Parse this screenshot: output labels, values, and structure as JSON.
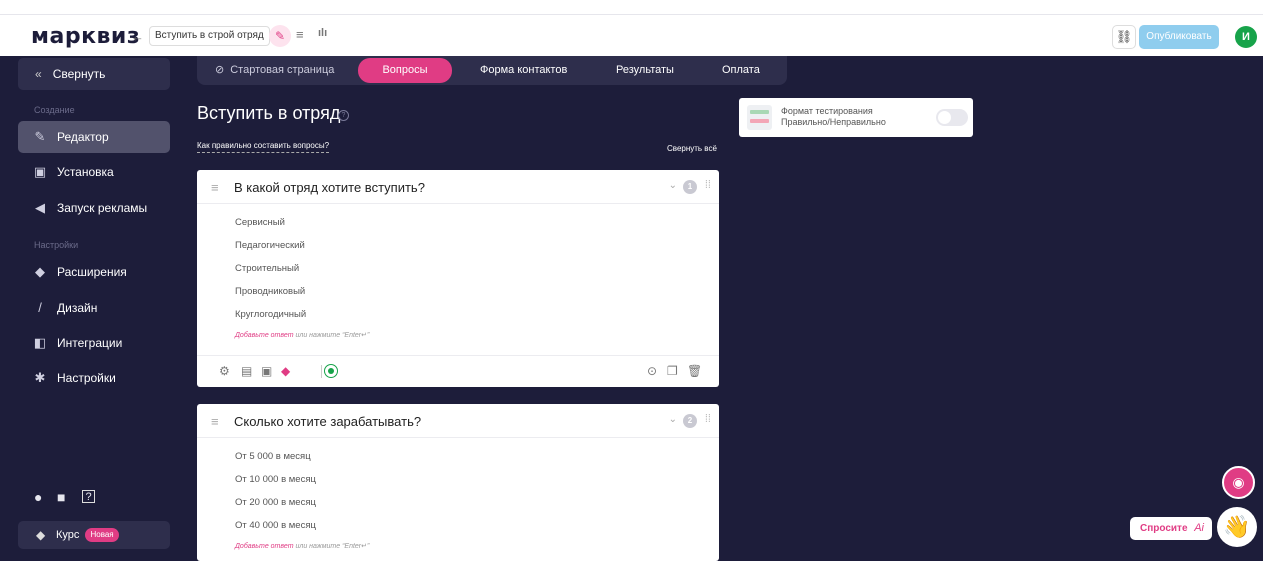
{
  "header": {
    "logo": "марквиз",
    "back": "←",
    "quiz_title": "Вступить в строй отряд",
    "edit_icon": "✎",
    "list_icon": "≡",
    "stats_icon": "ılı",
    "link_icon": "⛓",
    "publish_label": "Опубликовать",
    "avatar_letter": "И"
  },
  "sidebar": {
    "collapse_label": "Свернуть",
    "section_create": "Создание",
    "section_settings": "Настройки",
    "items": [
      {
        "label": "Редактор",
        "icon": "✎"
      },
      {
        "label": "Установка",
        "icon": "▣"
      },
      {
        "label": "Запуск рекламы",
        "icon": "◀"
      },
      {
        "label": "Расширения",
        "icon": "◆"
      },
      {
        "label": "Дизайн",
        "icon": "/"
      },
      {
        "label": "Интеграции",
        "icon": "◧"
      },
      {
        "label": "Настройки",
        "icon": "✱"
      }
    ],
    "course_label": "Курс",
    "course_badge": "Новая"
  },
  "tabs": [
    {
      "label": "Стартовая страница"
    },
    {
      "label": "Вопросы"
    },
    {
      "label": "Форма контактов"
    },
    {
      "label": "Результаты"
    },
    {
      "label": "Оплата"
    }
  ],
  "main": {
    "title": "Вступить в отряд",
    "help_mark": "?",
    "how_link": "Как правильно составить вопросы?",
    "collapse_all": "Свернуть всё"
  },
  "format_card": {
    "line1": "Формат тестирования",
    "line2": "Правильно/Неправильно",
    "enabled": false
  },
  "questions": [
    {
      "title": "В какой отряд хотите вступить?",
      "number": "1",
      "answers": [
        "Сервисный",
        "Педагогический",
        "Строительный",
        "Проводниковый",
        "Круглогодичный"
      ],
      "add_answer": "Добавьте ответ",
      "add_hint": " или нажмите “Enter↵”"
    },
    {
      "title": "Сколько хотите зарабатывать?",
      "number": "2",
      "answers": [
        "От 5 000 в месяц",
        "От 10 000 в месяц",
        "От 20 000 в месяц",
        "От 40 000 в месяц"
      ],
      "add_answer": "Добавьте ответ",
      "add_hint": " или нажмите “Enter↵”"
    }
  ],
  "floating": {
    "ask_label": "Спросите",
    "ask_ai": "Ai",
    "wave": "👋"
  },
  "colors": {
    "accent": "#e03c84",
    "sidebar_bg": "#1d1d3a",
    "publish": "#8fcdee",
    "avatar": "#17a34a"
  }
}
